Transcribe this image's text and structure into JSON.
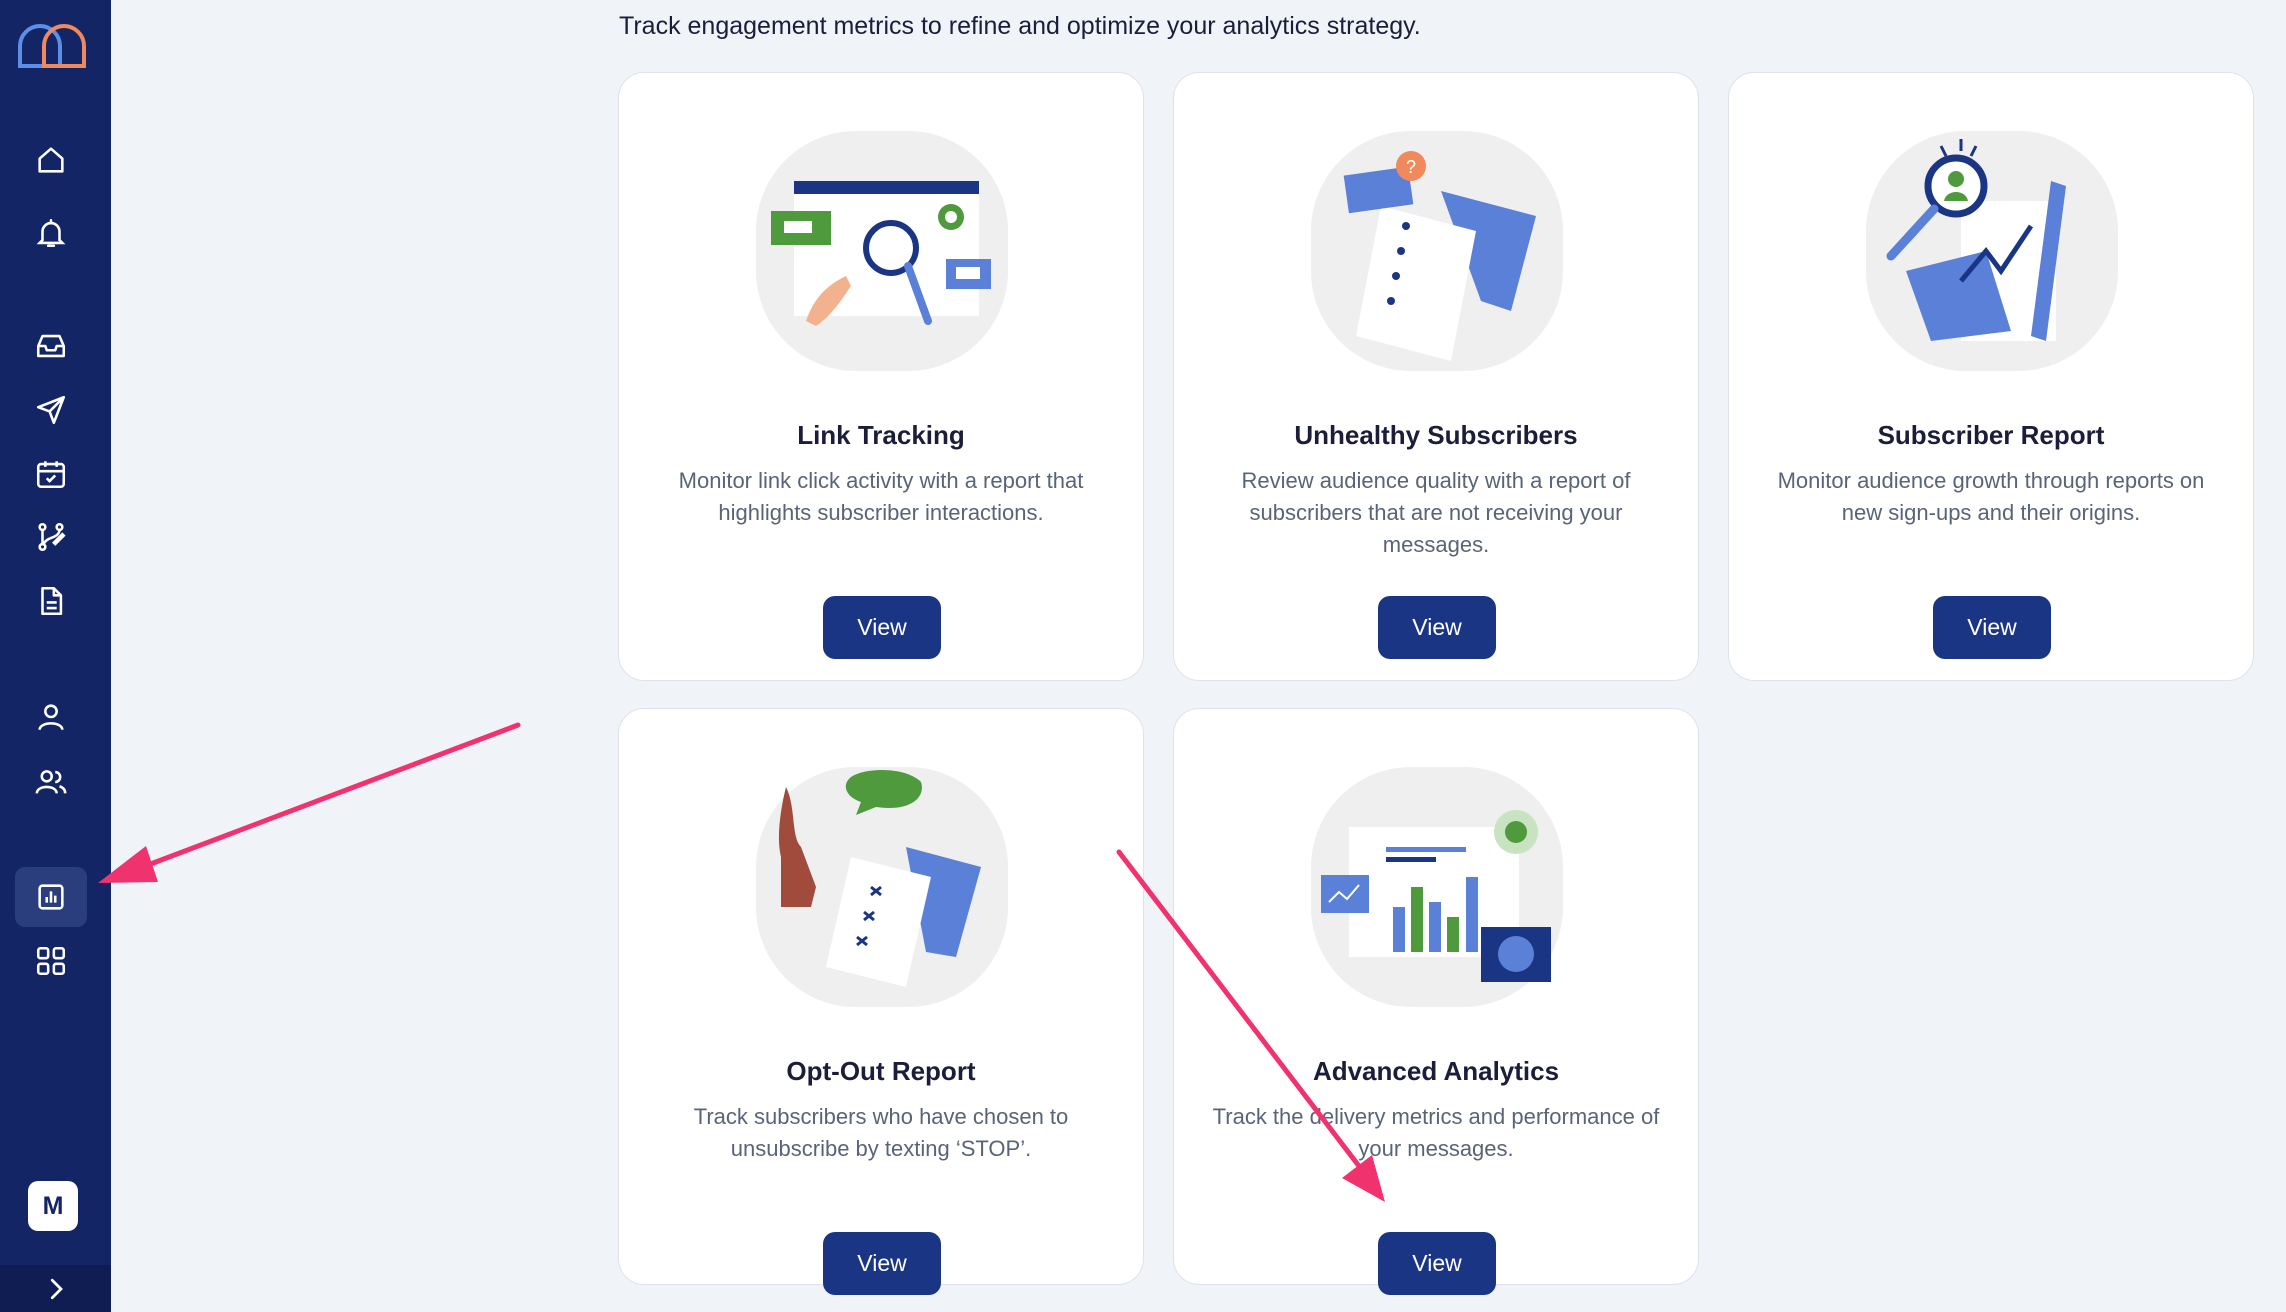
{
  "sidebar": {
    "items": [
      {
        "name": "home-icon"
      },
      {
        "name": "bell-icon"
      },
      {
        "name": "inbox-icon"
      },
      {
        "name": "send-icon"
      },
      {
        "name": "calendar-icon"
      },
      {
        "name": "workflow-icon"
      },
      {
        "name": "document-icon"
      },
      {
        "name": "user-icon"
      },
      {
        "name": "users-icon"
      },
      {
        "name": "analytics-icon",
        "active": true
      },
      {
        "name": "apps-grid-icon"
      }
    ],
    "avatar_initial": "M",
    "expand_icon": "chevron-right-icon"
  },
  "intro_text": "Track engagement metrics to refine and optimize your analytics strategy.",
  "cards": [
    {
      "title": "Link Tracking",
      "description": "Monitor link click activity with a report that highlights subscriber interactions.",
      "button": "View"
    },
    {
      "title": "Unhealthy Subscribers",
      "description": "Review audience quality with a report of subscribers that are not receiving your messages.",
      "button": "View"
    },
    {
      "title": "Subscriber Report",
      "description": "Monitor audience growth through reports on new sign-ups and their origins.",
      "button": "View"
    },
    {
      "title": "Opt-Out Report",
      "description": "Track subscribers who have chosen to unsubscribe by texting ‘STOP’.",
      "button": "View"
    },
    {
      "title": "Advanced Analytics",
      "description": "Track the delivery metrics and performance of your messages.",
      "button": "View"
    }
  ],
  "colors": {
    "sidebar": "#142565",
    "button": "#1b3585",
    "accent_arrow": "#f0336f",
    "green": "#4e9a3c",
    "blue": "#5b80d8"
  }
}
